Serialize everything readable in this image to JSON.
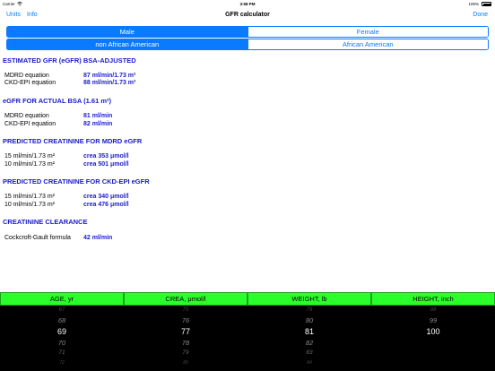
{
  "status_bar": {
    "carrier": "Carrier",
    "time": "3:58 PM",
    "battery": "100%"
  },
  "nav": {
    "units": "Units",
    "info": "Info",
    "title": "GFR calculator",
    "done": "Done"
  },
  "gender": {
    "options": [
      "Male",
      "Female"
    ],
    "selected": "Male"
  },
  "race": {
    "options": [
      "non African American",
      "African American"
    ],
    "selected": "non African American"
  },
  "sections": [
    {
      "title": "ESTIMATED GFR (eGFR) BSA-ADJUSTED",
      "rows": [
        {
          "label": "MDRD equation",
          "value": "87 ml/min/1.73 m²"
        },
        {
          "label": "CKD-EPI equation",
          "value": "88 ml/min/1.73 m²"
        }
      ]
    },
    {
      "title": "eGFR FOR ACTUAL BSA (1.61 m²)",
      "rows": [
        {
          "label": "MDRD equation",
          "value": "81 ml/min"
        },
        {
          "label": "CKD-EPI equation",
          "value": "82 ml/min"
        }
      ]
    },
    {
      "title": "PREDICTED CREATININE FOR MDRD eGFR",
      "rows": [
        {
          "label": "15 ml/min/1.73 m²",
          "value": "crea 353 μmol/l"
        },
        {
          "label": "10 ml/min/1.73 m²",
          "value": "crea 501 μmol/l"
        }
      ]
    },
    {
      "title": "PREDICTED CREATININE FOR CKD-EPI eGFR",
      "rows": [
        {
          "label": "15 ml/min/1.73 m²",
          "value": "crea 340 μmol/l"
        },
        {
          "label": "10 ml/min/1.73 m²",
          "value": "crea 476 μmol/l"
        }
      ]
    },
    {
      "title": "CREATININE CLEARANCE",
      "rows": [
        {
          "label": "Cockcroft-Gault formula",
          "value": "42 ml/min"
        }
      ]
    }
  ],
  "pickers": [
    {
      "header": "AGE, yr",
      "values": [
        "67",
        "68",
        "69",
        "70",
        "71",
        "72"
      ],
      "selected": "69"
    },
    {
      "header": "CREA, μmol/l",
      "values": [
        "75",
        "76",
        "77",
        "78",
        "79",
        "80"
      ],
      "selected": "77"
    },
    {
      "header": "WEIGHT, lb",
      "values": [
        "79",
        "80",
        "81",
        "82",
        "83",
        "84"
      ],
      "selected": "81"
    },
    {
      "header": "HEIGHT, inch",
      "values": [
        "98",
        "99",
        "100",
        "",
        "",
        ""
      ],
      "selected": "100"
    }
  ],
  "colors": {
    "accent": "#0a7aff",
    "result_blue": "#1a1acc",
    "picker_header": "#2bff2b",
    "picker_bg": "#000000"
  }
}
